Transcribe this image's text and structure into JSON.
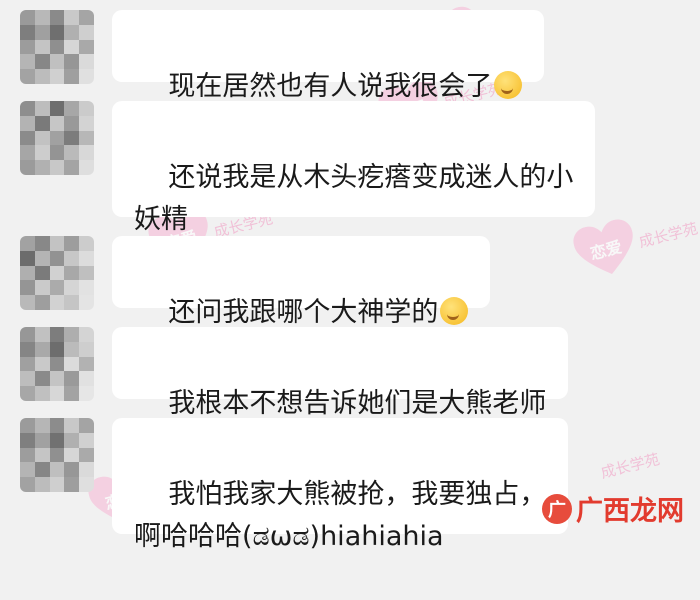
{
  "chat": {
    "messages": [
      {
        "text": "现在居然也有人说我很会了",
        "emoji": "thinking-face-icon"
      },
      {
        "text": "还说我是从木头疙瘩变成迷人的小\n妖精",
        "emoji": ""
      },
      {
        "text": "还问我跟哪个大神学的",
        "emoji": "thinking-face-icon"
      },
      {
        "text": "我根本不想告诉她们是大熊老师",
        "emoji": ""
      },
      {
        "text": "我怕我家大熊被抢，我要独占，\n啊哈哈哈(ಡωಡ)hiahiahia",
        "emoji": ""
      }
    ]
  },
  "watermark": {
    "main": "恋爱",
    "sub": "成长学苑"
  },
  "footer": {
    "logo": "广",
    "text": "广西龙网"
  },
  "colors": {
    "background": "#f1f1f1",
    "bubble": "#ffffff",
    "watermark": "#f19ac3",
    "footer": "#e23b2e"
  }
}
